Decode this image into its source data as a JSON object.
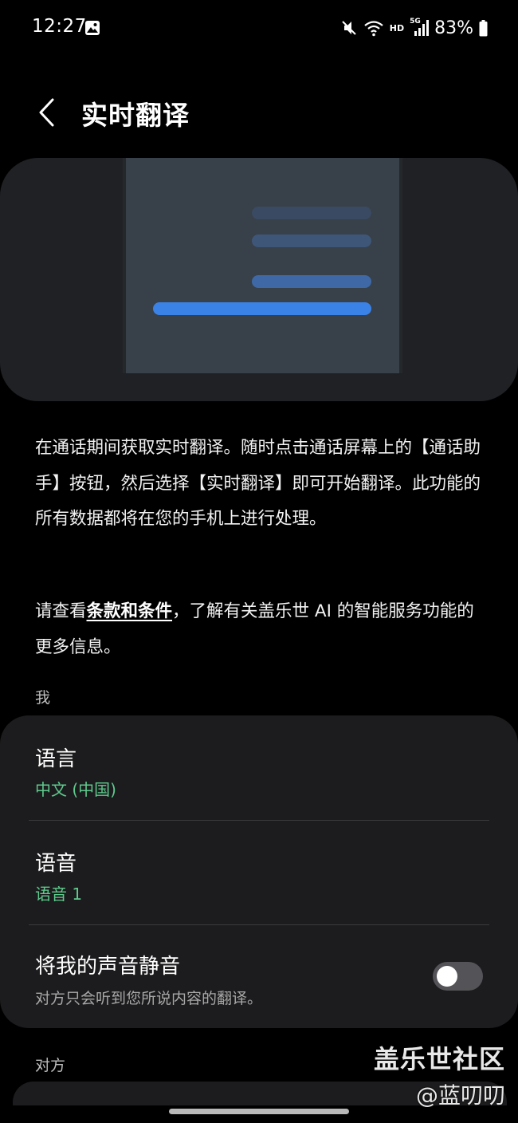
{
  "status_bar": {
    "time": "12:27",
    "network_hd": "HD",
    "network_5g": "5G",
    "battery": "83%"
  },
  "header": {
    "title": "实时翻译"
  },
  "description": {
    "intro": "在通话期间获取实时翻译。随时点击通话屏幕上的【通话助手】按钮，然后选择【实时翻译】即可开始翻译。此功能的所有数据都将在您的手机上进行处理。",
    "terms_prefix": "请查看",
    "terms_link": "条款和条件",
    "terms_suffix": "，了解有关盖乐世 AI 的智能服务功能的更多信息。"
  },
  "sections": {
    "me_label": "我",
    "other_label": "对方"
  },
  "settings": {
    "language": {
      "title": "语言",
      "value": "中文 (中国)"
    },
    "voice": {
      "title": "语音",
      "value": "语音 1"
    },
    "mute": {
      "title": "将我的声音静音",
      "description": "对方只会听到您所说内容的翻译。",
      "enabled": false
    }
  },
  "watermark": {
    "main": "盖乐世社区",
    "sub": "@蓝叨叨"
  },
  "colors": {
    "accent_green": "#5fca8d",
    "accent_blue": "#3b82e6"
  }
}
